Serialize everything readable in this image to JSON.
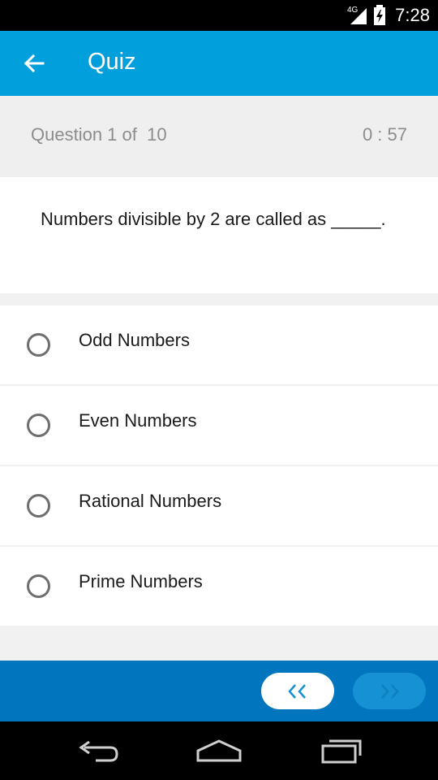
{
  "status_bar": {
    "network_type": "4G",
    "time": "7:28",
    "icons": [
      "signal-icon",
      "battery-charging-icon"
    ]
  },
  "app_bar": {
    "title": "Quiz",
    "back_icon": "arrow-left-icon",
    "color": "#019fdb"
  },
  "quiz": {
    "counter": "Question 1 of  10",
    "timer": "0 : 57",
    "question": "Numbers divisible by 2 are called as _____.",
    "options": [
      {
        "label": "Odd Numbers",
        "selected": false
      },
      {
        "label": "Even Numbers",
        "selected": false
      },
      {
        "label": "Rational Numbers",
        "selected": false
      },
      {
        "label": "Prime Numbers",
        "selected": false
      }
    ]
  },
  "navigation": {
    "prev_icon": "double-chevron-left-icon",
    "next_icon": "double-chevron-right-icon",
    "next_enabled": false,
    "bar_color": "#0175bd"
  },
  "system_nav": {
    "icons": [
      "back-icon",
      "home-icon",
      "recents-icon"
    ]
  }
}
